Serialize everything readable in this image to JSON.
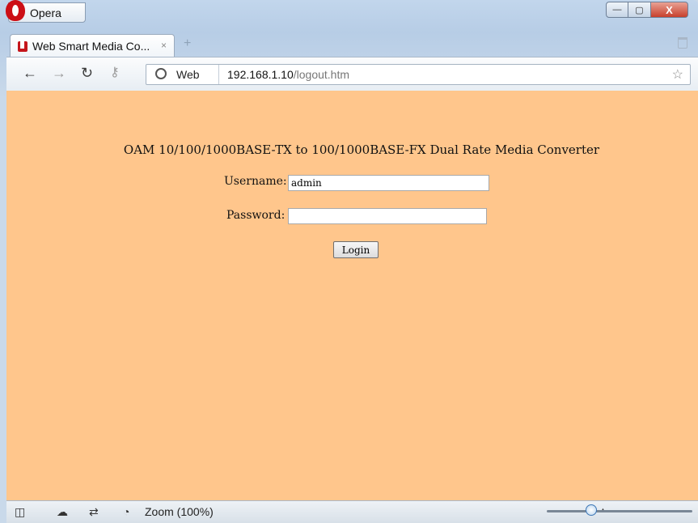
{
  "browser": {
    "menu_label": "Opera",
    "tab_title": "Web Smart Media Co...",
    "tab_close": "×",
    "new_tab": "+",
    "address_scheme_label": "Web",
    "url_host": "192.168.1.10",
    "url_path": "/logout.htm",
    "window_buttons": {
      "minimize": "—",
      "maximize": "▢",
      "close": "X"
    }
  },
  "page": {
    "heading": "OAM 10/100/1000BASE-TX to 100/1000BASE-FX Dual Rate Media Converter",
    "username_label": "Username:",
    "username_value": "admin",
    "password_label": "Password:",
    "password_value": "",
    "login_button": "Login"
  },
  "statusbar": {
    "zoom_label": "Zoom (100%)",
    "zoom_percent": 100
  },
  "colors": {
    "page_background": "#ffc68c",
    "brand": "#cc0f16"
  },
  "icons": [
    "opera-logo-icon",
    "tab-favicon-icon",
    "back-icon",
    "forward-icon",
    "reload-icon",
    "key-icon",
    "globe-icon",
    "star-icon",
    "trash-icon",
    "panel-icon",
    "cloud-icon",
    "share-icon",
    "speed-icon"
  ]
}
